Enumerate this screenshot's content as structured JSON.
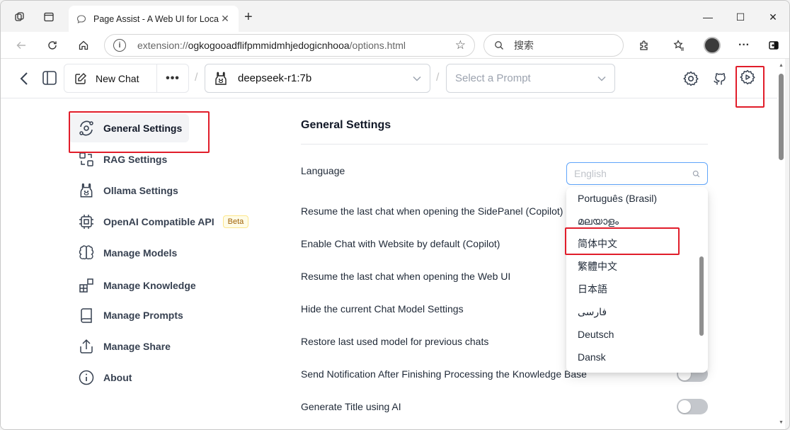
{
  "browser": {
    "tab_title": "Page Assist - A Web UI for Local A",
    "url_prefix": "extension://",
    "url_host": "ogkogooadflifpmmidmhjedogicnhooa",
    "url_path": "/options.html",
    "search_placeholder": "搜索",
    "new_tab": "+",
    "minimize": "—",
    "maximize": "☐",
    "close": "✕",
    "more": "···"
  },
  "header": {
    "new_chat_label": "New Chat",
    "more_label": "•••",
    "separator": "/",
    "model_value": "deepseek-r1:7b",
    "prompt_placeholder": "Select a Prompt"
  },
  "sidebar": {
    "items": [
      {
        "label": "General Settings",
        "icon": "orbit-icon"
      },
      {
        "label": "RAG Settings",
        "icon": "rag-icon"
      },
      {
        "label": "Ollama Settings",
        "icon": "llama-icon"
      },
      {
        "label": "OpenAI Compatible API",
        "icon": "chip-icon",
        "badge": "Beta"
      },
      {
        "label": "Manage Models",
        "icon": "brain-icon"
      },
      {
        "label": "Manage Knowledge",
        "icon": "blocks-icon"
      },
      {
        "label": "Manage Prompts",
        "icon": "book-icon"
      },
      {
        "label": "Manage Share",
        "icon": "share-icon"
      },
      {
        "label": "About",
        "icon": "info-icon"
      }
    ]
  },
  "main": {
    "title": "General Settings",
    "language_label": "Language",
    "language_search_placeholder": "English",
    "settings": [
      "Resume the last chat when opening the SidePanel (Copilot)",
      "Enable Chat with Website by default (Copilot)",
      "Resume the last chat when opening the Web UI",
      "Hide the current Chat Model Settings",
      "Restore last used model for previous chats",
      "Send Notification After Finishing Processing the Knowledge Base",
      "Generate Title using AI"
    ],
    "language_options": [
      "Português (Brasil)",
      "മലയാളം",
      "简体中文",
      "繁體中文",
      "日本語",
      "فارسی",
      "Deutsch",
      "Dansk"
    ],
    "toggles": [
      false,
      false
    ]
  },
  "colors": {
    "highlight_box": "#e11d2a",
    "focus_border": "#60a5fa",
    "badge_bg": "#fefce8",
    "toggle_off": "#c4c7cc"
  }
}
